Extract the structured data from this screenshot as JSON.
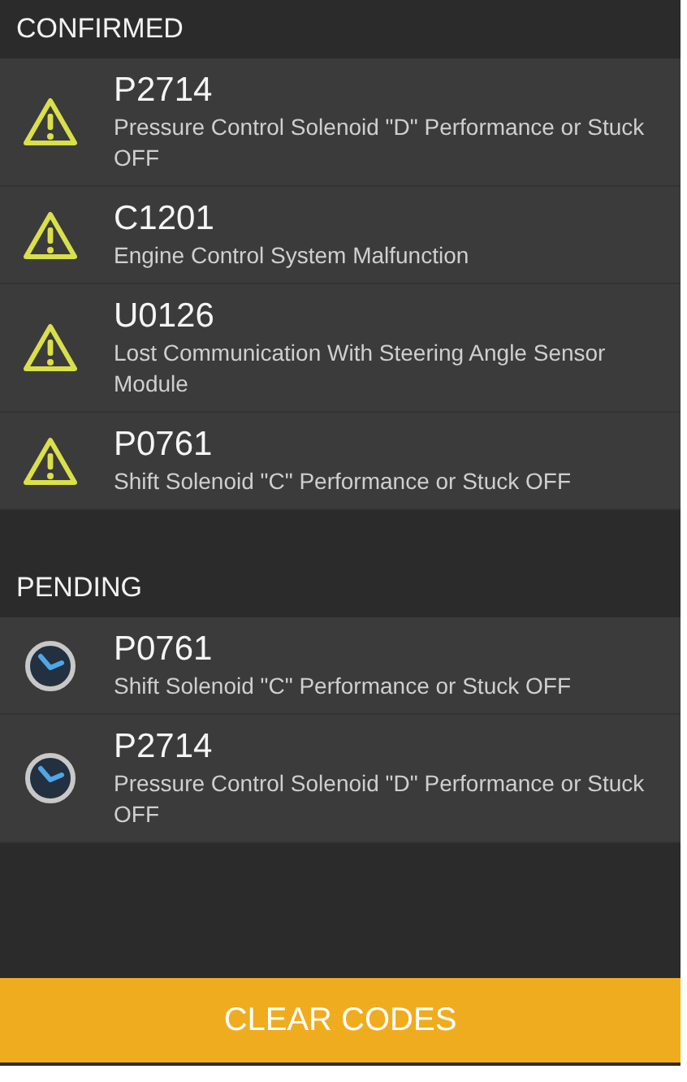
{
  "sections": [
    {
      "title": "CONFIRMED",
      "kind": "confirmed",
      "codes": [
        {
          "code": "P2714",
          "description": "Pressure Control Solenoid \"D\" Performance or Stuck OFF"
        },
        {
          "code": "C1201",
          "description": "Engine Control System Malfunction"
        },
        {
          "code": "U0126",
          "description": "Lost Communication With Steering Angle Sensor Module"
        },
        {
          "code": "P0761",
          "description": "Shift Solenoid \"C\" Performance or Stuck OFF"
        }
      ]
    },
    {
      "title": "PENDING",
      "kind": "pending",
      "codes": [
        {
          "code": "P0761",
          "description": "Shift Solenoid \"C\" Performance or Stuck OFF"
        },
        {
          "code": "P2714",
          "description": "Pressure Control Solenoid \"D\" Performance or Stuck OFF"
        }
      ]
    }
  ],
  "button": {
    "label": "CLEAR CODES"
  }
}
